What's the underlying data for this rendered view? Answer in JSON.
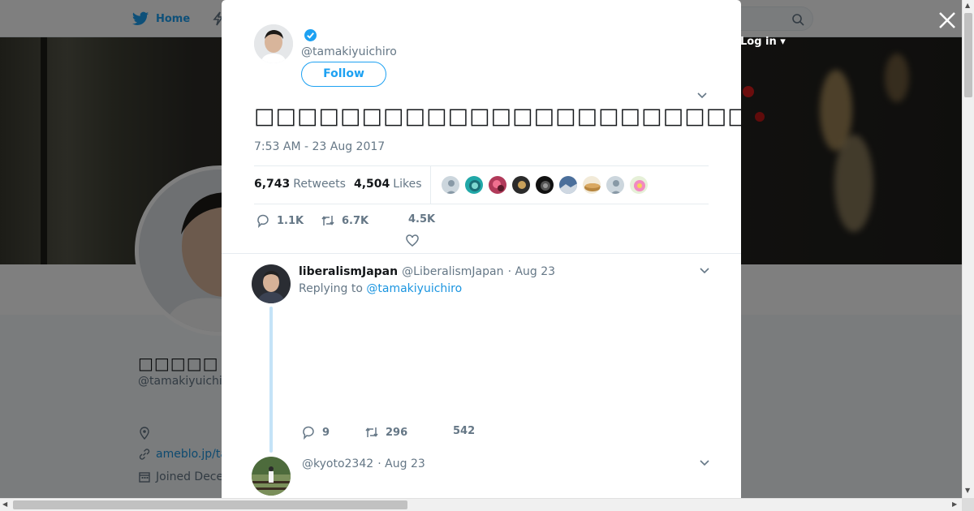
{
  "nav": {
    "home_label": "Home",
    "login_label": "Log in"
  },
  "profile": {
    "name": "□□□□□",
    "handle": "@tamakiyuichiro",
    "link": "ameblo.jp/ta",
    "joined": "Joined Dece"
  },
  "tweet": {
    "handle": "@tamakiyuichiro",
    "follow_label": "Follow",
    "text": "□□□□□□□□□□□□□□□□□□□□□□□□□□□□□□□□□□□□□□□□□□□□□□□□□□□□□□□□□□□□",
    "time": "7:53 AM - 23 Aug 2017",
    "retweets_count": "6,743",
    "retweets_label": "Retweets",
    "likes_count": "4,504",
    "likes_label": "Likes",
    "reply_action": "1.1K",
    "retweet_action": "6.7K",
    "like_action": "4.5K"
  },
  "replies": [
    {
      "name": "liberalismJapan",
      "handle": "@LiberalismJapan",
      "date": "· Aug 23",
      "replying_prefix": "Replying to",
      "replying_to": "@tamakiyuichiro",
      "reply_count": "9",
      "retweet_count": "296",
      "like_count": "542"
    },
    {
      "name": "",
      "handle": "@kyoto2342",
      "date": "· Aug 23"
    }
  ],
  "colors": {
    "accent": "#1da1f2",
    "link": "#1b95e0",
    "muted": "#657786",
    "thread": "#c4e3f7"
  }
}
